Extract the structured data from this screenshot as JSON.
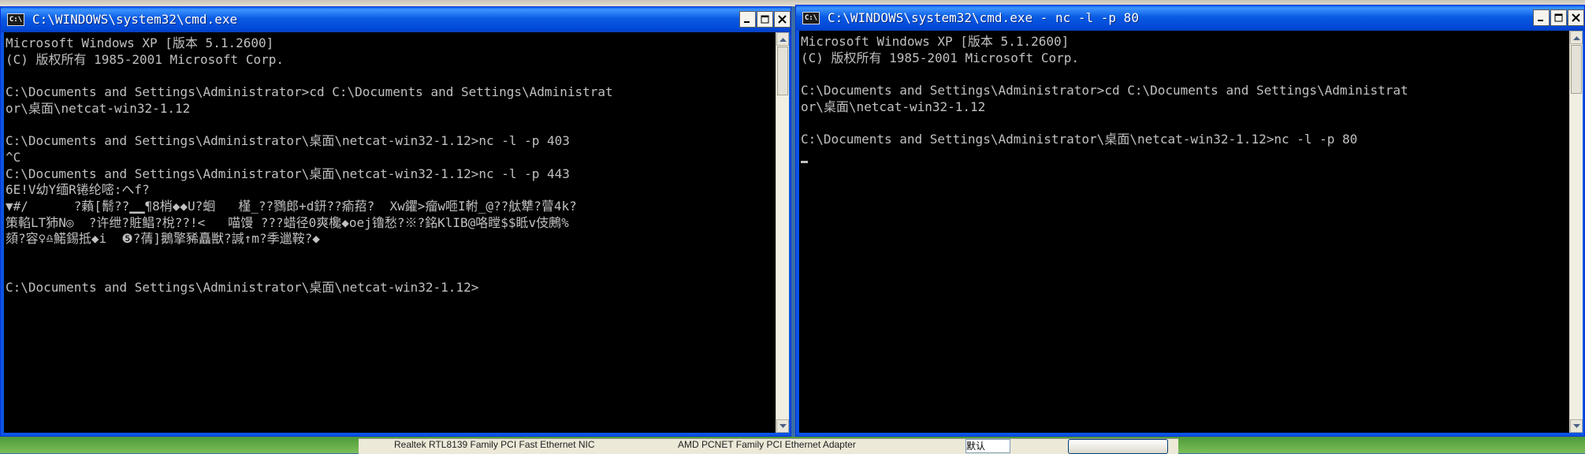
{
  "background": {
    "taskbar_left_text": "Realtek RTL8139 Family PCI Fast Ethernet NIC",
    "taskbar_mid_text": "AMD PCNET Family PCI Ethernet Adapter",
    "taskbar_select_value": "默认"
  },
  "left_window": {
    "title": "C:\\WINDOWS\\system32\\cmd.exe",
    "icon_label": "C:\\",
    "lines": [
      "Microsoft Windows XP [版本 5.1.2600]",
      "(C) 版权所有 1985-2001 Microsoft Corp.",
      "",
      "C:\\Documents and Settings\\Administrator>cd C:\\Documents and Settings\\Administrat",
      "or\\桌面\\netcat-win32-1.12",
      "",
      "C:\\Documents and Settings\\Administrator\\桌面\\netcat-win32-1.12>nc -l -p 403",
      "^C",
      "C:\\Documents and Settings\\Administrator\\桌面\\netcat-win32-1.12>nc -l -p 443",
      "6E!V幼Y缅R锩纶嘧:へf?",
      "▼#/      ?藾[鬋??▁▁¶8梢◆◆U?蛔   槿_??鷚郎+d鈃??瘉萔?  Xw鑺>瘤w咂I軵_@??舦犨?萺4k?",
      "策輡LT犻N◎  ?许绁?賍鲳?梲??!<   喵馒 ???蜡径0爽欃◆oej镥愁?※?銘KlIB@咯瞠$$眡v伎鶊%",
      "頦?容♀♎鰙錫抵◆i  ❺?蒨]鵝擎豨矗獣?諴↑m?季邋鞍?◆",
      "",
      "",
      "C:\\Documents and Settings\\Administrator\\桌面\\netcat-win32-1.12>"
    ]
  },
  "right_window": {
    "title": "C:\\WINDOWS\\system32\\cmd.exe - nc -l -p 80",
    "icon_label": "C:\\",
    "lines": [
      "Microsoft Windows XP [版本 5.1.2600]",
      "(C) 版权所有 1985-2001 Microsoft Corp.",
      "",
      "C:\\Documents and Settings\\Administrator>cd C:\\Documents and Settings\\Administrat",
      "or\\桌面\\netcat-win32-1.12",
      "",
      "C:\\Documents and Settings\\Administrator\\桌面\\netcat-win32-1.12>nc -l -p 80"
    ]
  },
  "colors": {
    "titlebar": "#0a5be3",
    "console_bg": "#000000",
    "console_fg": "#c0c0c0"
  },
  "icons": [
    "cmd-icon",
    "minimize-icon",
    "maximize-icon",
    "close-icon",
    "scroll-up-icon",
    "scroll-down-icon"
  ]
}
